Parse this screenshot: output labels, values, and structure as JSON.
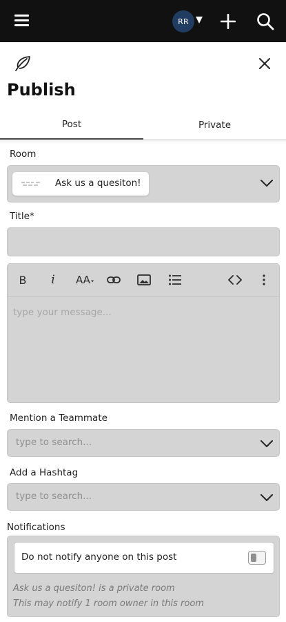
{
  "topbar": {
    "avatar_initials": "RR",
    "icons": [
      "hamburger-menu-icon",
      "caret-down-icon",
      "plus-icon",
      "search-icon"
    ],
    "background": "#111111",
    "avatar_color": "#213c61"
  },
  "header": {
    "title": "Publish",
    "icons": [
      "feather-icon",
      "close-icon"
    ]
  },
  "tabs": [
    {
      "label": "Post",
      "active": true
    },
    {
      "label": "Private",
      "active": false
    }
  ],
  "room": {
    "label": "Room",
    "selected": "Ask us a quesiton!"
  },
  "title_field": {
    "label": "Title*",
    "value": ""
  },
  "editor": {
    "toolbar": {
      "bold": "B",
      "italic": "i",
      "font_size": "AA",
      "icons": [
        "bold-icon",
        "italic-icon",
        "font-size-icon",
        "link-icon",
        "image-icon",
        "bulleted-list-icon",
        "code-icon",
        "more-options-icon"
      ]
    },
    "placeholder": "type your message..."
  },
  "mention": {
    "label": "Mention a Teammate",
    "placeholder": "type to search..."
  },
  "hashtag": {
    "label": "Add a Hashtag",
    "placeholder": "type to search..."
  },
  "notifications": {
    "label": "Notifications",
    "option": "Do not notify anyone on this post",
    "toggle_on": false,
    "note_1": "Ask us a quesiton! is a private room",
    "note_2": "This may notify 1 room owner in this room"
  },
  "colors": {
    "field_bg": "#d4d4d4",
    "text": "#222222",
    "placeholder": "#a7a7a7"
  }
}
